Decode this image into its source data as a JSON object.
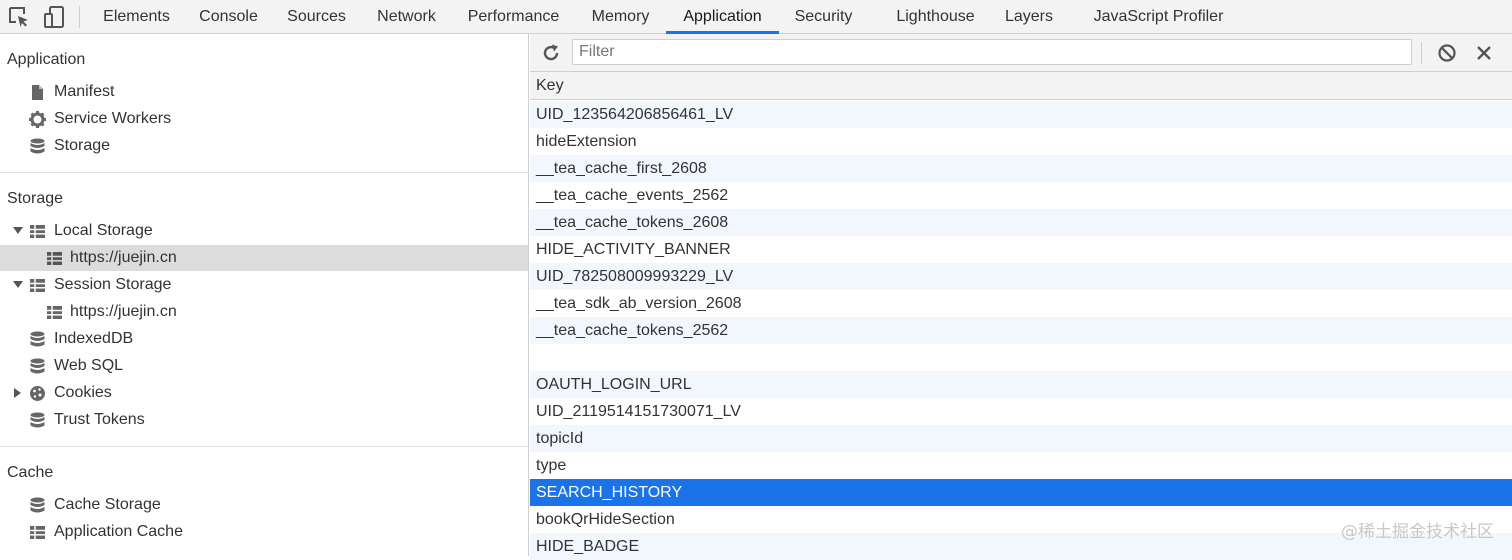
{
  "tabs": [
    {
      "label": "Elements"
    },
    {
      "label": "Console"
    },
    {
      "label": "Sources"
    },
    {
      "label": "Network"
    },
    {
      "label": "Performance"
    },
    {
      "label": "Memory"
    },
    {
      "label": "Application"
    },
    {
      "label": "Security"
    },
    {
      "label": "Lighthouse"
    },
    {
      "label": "Layers"
    },
    {
      "label": "JavaScript Profiler"
    }
  ],
  "active_tab": "Application",
  "accent_color": "#1a73e8",
  "sidebar": {
    "application": {
      "title": "Application",
      "items": [
        {
          "label": "Manifest",
          "icon": "document-icon"
        },
        {
          "label": "Service Workers",
          "icon": "gear-icon"
        },
        {
          "label": "Storage",
          "icon": "database-icon"
        }
      ]
    },
    "storage": {
      "title": "Storage",
      "items": [
        {
          "label": "Local Storage",
          "icon": "grid-icon",
          "expanded": true
        },
        {
          "label": "https://juejin.cn",
          "icon": "grid-icon",
          "selected": true
        },
        {
          "label": "Session Storage",
          "icon": "grid-icon",
          "expanded": true
        },
        {
          "label": "https://juejin.cn",
          "icon": "grid-icon"
        },
        {
          "label": "IndexedDB",
          "icon": "database-icon"
        },
        {
          "label": "Web SQL",
          "icon": "database-icon"
        },
        {
          "label": "Cookies",
          "icon": "cookie-icon",
          "expanded": false
        },
        {
          "label": "Trust Tokens",
          "icon": "database-icon"
        }
      ]
    },
    "cache": {
      "title": "Cache",
      "items": [
        {
          "label": "Cache Storage",
          "icon": "database-icon"
        },
        {
          "label": "Application Cache",
          "icon": "grid-icon"
        }
      ]
    }
  },
  "filter": {
    "placeholder": "Filter",
    "value": ""
  },
  "table": {
    "column": "Key",
    "rows": [
      "UID_123564206856461_LV",
      "hideExtension",
      "__tea_cache_first_2608",
      "__tea_cache_events_2562",
      "__tea_cache_tokens_2608",
      "HIDE_ACTIVITY_BANNER",
      "UID_782508009993229_LV",
      "__tea_sdk_ab_version_2608",
      "__tea_cache_tokens_2562",
      "",
      "OAUTH_LOGIN_URL",
      "UID_2119514151730071_LV",
      "topicId",
      "type",
      "SEARCH_HISTORY",
      "bookQrHideSection",
      "HIDE_BADGE"
    ],
    "selected_row": "SEARCH_HISTORY"
  },
  "watermark": "@稀土掘金技术社区"
}
